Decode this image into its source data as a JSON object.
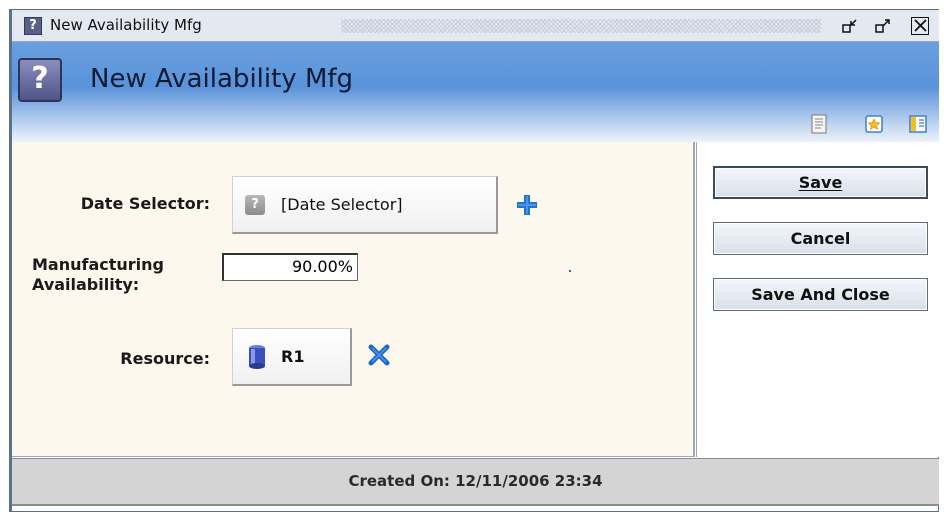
{
  "window": {
    "title": "New Availability Mfg",
    "title_icon": "question-icon",
    "controls": [
      "minimize-icon",
      "maximize-icon",
      "close-icon"
    ]
  },
  "header": {
    "title": "New Availability Mfg",
    "icon": "question-icon",
    "tools": [
      "document-icon",
      "star-icon",
      "panel-icon"
    ]
  },
  "form": {
    "date_selector": {
      "label": "Date Selector:",
      "value": "[Date Selector]",
      "icon": "question-icon",
      "action_icon": "add-icon"
    },
    "manufacturing_availability": {
      "label_line1": "Manufacturing",
      "label_line2": "Availability:",
      "value": "90.00%"
    },
    "resource": {
      "label": "Resource:",
      "value": "R1",
      "icon": "resource-cylinder-icon",
      "action_icon": "remove-icon"
    }
  },
  "actions": {
    "save_label": "Save",
    "cancel_label": "Cancel",
    "save_and_close_label": "Save And Close"
  },
  "status": {
    "created_on": "Created On: 12/11/2006 23:34"
  },
  "colors": {
    "header_blue": "#5a93da",
    "form_bg": "#fdf8ee",
    "add_blue": "#1f73d8",
    "status_bg": "#d4d4d4"
  }
}
